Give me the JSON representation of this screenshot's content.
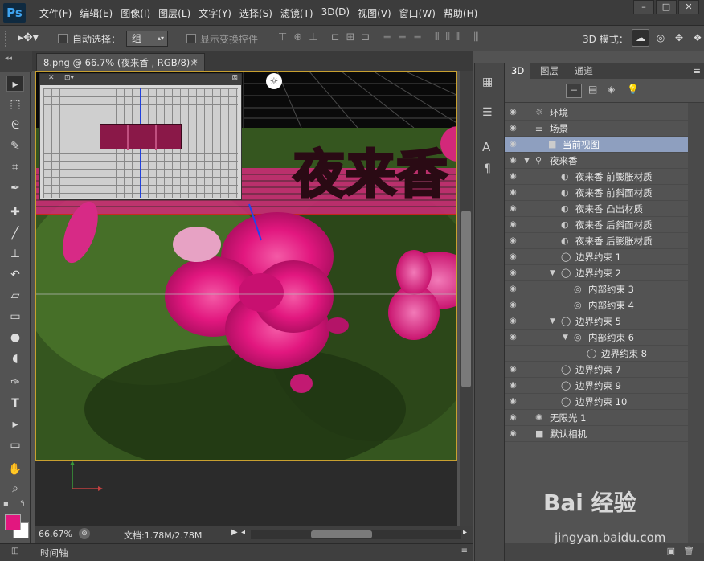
{
  "app": {
    "logo": "Ps"
  },
  "menu": [
    "文件(F)",
    "编辑(E)",
    "图像(I)",
    "图层(L)",
    "文字(Y)",
    "选择(S)",
    "滤镜(T)",
    "3D(D)",
    "视图(V)",
    "窗口(W)",
    "帮助(H)"
  ],
  "options": {
    "auto_select_label": "自动选择：",
    "auto_select_value": "组",
    "show_transform_label": "显示变换控件",
    "mode_label": "3D 模式："
  },
  "document": {
    "tab_title": "8.png @ 66.7% (夜来香 , RGB/8) *",
    "close": "×",
    "art_text": "夜来香"
  },
  "status": {
    "zoom": "66.67%",
    "doc_info": "文档:1.78M/2.78M"
  },
  "timeline": {
    "label": "时间轴"
  },
  "panel": {
    "tabs": [
      "3D",
      "图层",
      "通道"
    ],
    "rows": [
      {
        "label": "环境",
        "icon": "environment-icon",
        "indent": 0,
        "eye": true,
        "arrow": ""
      },
      {
        "label": "场景",
        "icon": "scene-icon",
        "indent": 0,
        "eye": true,
        "arrow": ""
      },
      {
        "label": "当前视图",
        "icon": "camera-icon",
        "indent": 1,
        "eye": true,
        "arrow": "",
        "selected": true
      },
      {
        "label": "夜来香",
        "icon": "mesh-icon",
        "indent": 0,
        "eye": true,
        "arrow": "▼"
      },
      {
        "label": "夜来香 前膨胀材质",
        "icon": "material-icon",
        "indent": 2,
        "eye": true,
        "arrow": ""
      },
      {
        "label": "夜来香 前斜面材质",
        "icon": "material-icon",
        "indent": 2,
        "eye": true,
        "arrow": ""
      },
      {
        "label": "夜来香 凸出材质",
        "icon": "material-icon",
        "indent": 2,
        "eye": true,
        "arrow": ""
      },
      {
        "label": "夜来香 后斜面材质",
        "icon": "material-icon",
        "indent": 2,
        "eye": true,
        "arrow": ""
      },
      {
        "label": "夜来香 后膨胀材质",
        "icon": "material-icon",
        "indent": 2,
        "eye": true,
        "arrow": ""
      },
      {
        "label": "边界约束 1",
        "icon": "constraint-icon",
        "indent": 2,
        "eye": true,
        "arrow": ""
      },
      {
        "label": "边界约束 2",
        "icon": "constraint-icon",
        "indent": 2,
        "eye": true,
        "arrow": "▼"
      },
      {
        "label": "内部约束 3",
        "icon": "inner-constraint-icon",
        "indent": 3,
        "eye": true,
        "arrow": ""
      },
      {
        "label": "内部约束 4",
        "icon": "inner-constraint-icon",
        "indent": 3,
        "eye": true,
        "arrow": ""
      },
      {
        "label": "边界约束 5",
        "icon": "constraint-icon",
        "indent": 2,
        "eye": true,
        "arrow": "▼"
      },
      {
        "label": "内部约束 6",
        "icon": "inner-constraint-icon",
        "indent": 3,
        "eye": true,
        "arrow": "▼"
      },
      {
        "label": "边界约束 8",
        "icon": "constraint-icon",
        "indent": 4,
        "eye": false,
        "arrow": ""
      },
      {
        "label": "边界约束 7",
        "icon": "constraint-icon",
        "indent": 2,
        "eye": true,
        "arrow": ""
      },
      {
        "label": "边界约束 9",
        "icon": "constraint-icon",
        "indent": 2,
        "eye": true,
        "arrow": ""
      },
      {
        "label": "边界约束 10",
        "icon": "constraint-icon",
        "indent": 2,
        "eye": true,
        "arrow": ""
      },
      {
        "label": "无限光 1",
        "icon": "light-icon",
        "indent": 0,
        "eye": true,
        "arrow": ""
      },
      {
        "label": "默认相机",
        "icon": "camera-icon",
        "indent": 0,
        "eye": true,
        "arrow": ""
      }
    ]
  },
  "colors": {
    "foreground": "#e2177f",
    "background": "#ffffff",
    "accent_selected": "#8e9fbf",
    "text_art": "#c2185b"
  },
  "watermark": {
    "text": "Bai 经验",
    "url": "jingyan.baidu.com"
  }
}
